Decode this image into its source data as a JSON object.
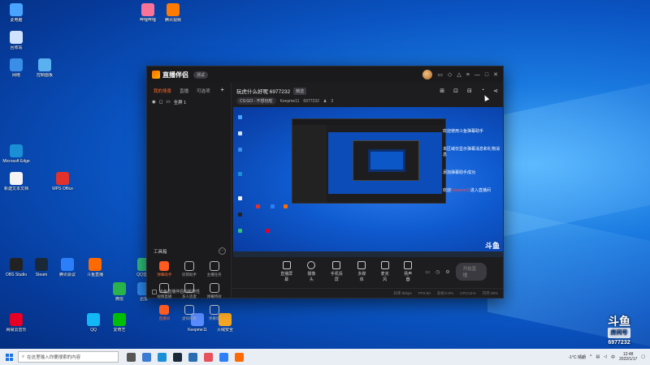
{
  "desktop": {
    "icons": [
      {
        "label": "此电脑",
        "color": "#4aa3ff"
      },
      {
        "label": "回收站",
        "color": "#cfe3ff"
      },
      {
        "label": "网络",
        "color": "#3a8ee8"
      },
      {
        "label": "控制面板",
        "color": "#5bb0f0"
      },
      {
        "label": "Microsoft Edge",
        "color": "#1b8fd6"
      },
      {
        "label": "新建文本文档",
        "color": "#f4f4f4"
      },
      {
        "label": "OBS Studio",
        "color": "#222222"
      },
      {
        "label": "Steam",
        "color": "#1b2838"
      },
      {
        "label": "腾讯会议",
        "color": "#2d7ff9"
      },
      {
        "label": "斗鱼直播",
        "color": "#ff6a00"
      },
      {
        "label": "QQ音乐",
        "color": "#31c27c"
      },
      {
        "label": "迅雷",
        "color": "#2d8cf0"
      },
      {
        "label": "WPS Office",
        "color": "#e0322b"
      },
      {
        "label": "网易云音乐",
        "color": "#e60026"
      },
      {
        "label": "微信",
        "color": "#2ab34a"
      },
      {
        "label": "QQ",
        "color": "#12b7f5"
      },
      {
        "label": "爱奇艺",
        "color": "#00be06"
      },
      {
        "label": "哔哩哔哩",
        "color": "#fb7299"
      },
      {
        "label": "腾讯视频",
        "color": "#ff7a00"
      },
      {
        "label": "Keepme11",
        "color": "#5a8cff"
      },
      {
        "label": "火绒安全",
        "color": "#f6a623"
      }
    ]
  },
  "window": {
    "app_name": "直播伴侣",
    "version_badge": "测试",
    "tb_icons": [
      "chat-icon",
      "gift-icon",
      "flask-icon",
      "menu-icon",
      "minimize-icon",
      "maximize-icon",
      "close-icon"
    ]
  },
  "sidebar": {
    "tabs": [
      "我的场景",
      "直播",
      "可选项"
    ],
    "scene_name": "全屏 1",
    "tools_title": "工具箱",
    "tools": [
      {
        "label": "弹幕助手",
        "hot": true
      },
      {
        "label": "房管助手",
        "hot": false
      },
      {
        "label": "主播任务",
        "hot": false
      },
      {
        "label": "视频直播",
        "hot": false
      },
      {
        "label": "多人连麦",
        "hot": false
      },
      {
        "label": "弹幕特效",
        "hot": false
      },
      {
        "label": "直播间",
        "hot": true
      },
      {
        "label": "虚拟形象",
        "hot": false
      },
      {
        "label": "弹幕墙",
        "hot": false
      }
    ],
    "tip": "出色直播伴侣的新特性"
  },
  "room": {
    "title": "玩虎什么好呢 6977232",
    "tag": "精选",
    "category": "CS:GO - 不想玩啦",
    "streamer": "Keepme11",
    "room_id": "6977232",
    "fans": "3"
  },
  "preview": {
    "messages": [
      {
        "text": "欢迎使用斗鱼弹幕助手",
        "highlight": ""
      },
      {
        "text": "本区域仅显示弹幕消息和礼物消息",
        "highlight": ""
      },
      {
        "text": "添加弹幕助手成功",
        "highlight": ""
      },
      {
        "text": "欢迎",
        "highlight": "Keepme11",
        "rest": "进入直播间"
      }
    ],
    "watermark": "斗鱼"
  },
  "controls": [
    {
      "label": "直播屏幕",
      "icon": "screen-icon"
    },
    {
      "label": "摄像头",
      "icon": "camera-icon"
    },
    {
      "label": "手机投屏",
      "icon": "phone-icon"
    },
    {
      "label": "多媒体",
      "icon": "media-icon"
    },
    {
      "label": "麦克风",
      "icon": "mic-icon"
    },
    {
      "label": "扬声器",
      "icon": "speaker-icon"
    }
  ],
  "go_live": "开始直播",
  "status": [
    "码率:0kbps",
    "FPS:60",
    "丢帧:0.0%",
    "CPU:11%",
    "内存:39%"
  ],
  "taskbar": {
    "search_placeholder": "在这里输入你要搜索的内容",
    "apps": [
      "#555555",
      "#3b7bd4",
      "#1b8fd6",
      "#1b2838",
      "#2a6db0",
      "#e8505b",
      "#2d7ff9",
      "#ff6a00"
    ],
    "weather": "-1°C 晴朗",
    "time": "12:48",
    "date": "2022/1/17"
  },
  "stream_watermark": {
    "logo": "斗鱼",
    "label": "房间号",
    "room_id": "6977232"
  }
}
